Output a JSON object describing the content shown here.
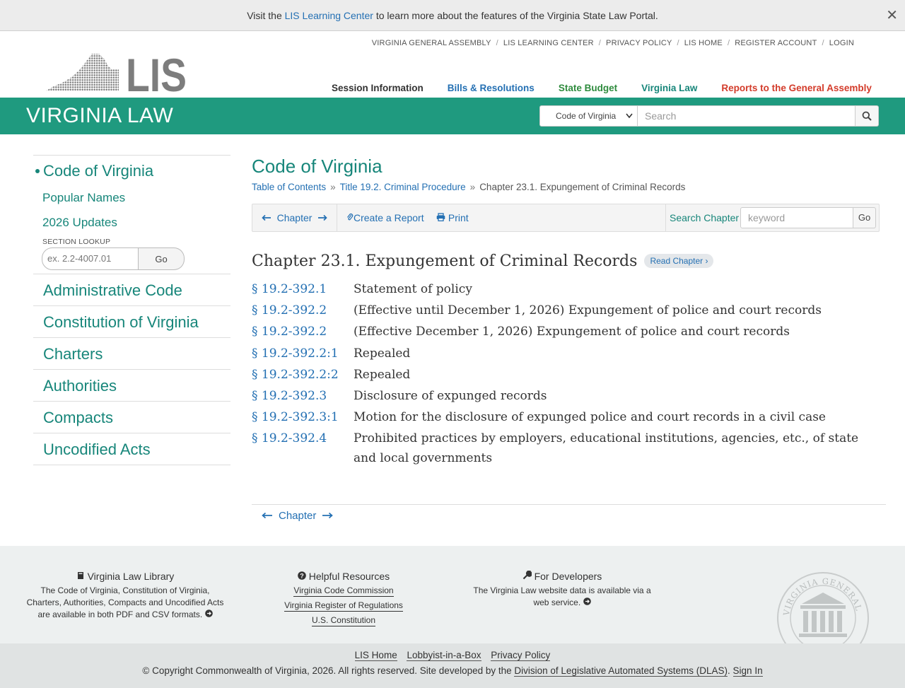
{
  "notice": {
    "before": "Visit the ",
    "link": "LIS Learning Center",
    "after": " to learn more about the features of the Virginia State Law Portal.",
    "close": "✕"
  },
  "topnav": [
    "VIRGINIA GENERAL ASSEMBLY",
    "LIS LEARNING CENTER",
    "PRIVACY POLICY",
    "LIS HOME",
    "REGISTER ACCOUNT",
    "LOGIN"
  ],
  "logo_text": "LIS",
  "mainnav": {
    "session": "Session Information",
    "bills": "Bills & Resolutions",
    "budget": "State Budget",
    "vlaw": "Virginia Law",
    "reports": "Reports to the General Assembly"
  },
  "banner": {
    "title": "VIRGINIA LAW",
    "scope_select": "Code of Virginia",
    "search_placeholder": "Search"
  },
  "sidebar": {
    "active": "Code of Virginia",
    "popular": "Popular Names",
    "updates": "2026 Updates",
    "lookup_label": "SECTION LOOKUP",
    "lookup_placeholder": "ex.  2.2-4007.01",
    "lookup_go": "Go",
    "items": [
      "Administrative Code",
      "Constitution of Virginia",
      "Charters",
      "Authorities",
      "Compacts",
      "Uncodified Acts"
    ]
  },
  "main": {
    "title": "Code of Virginia",
    "breadcrumb": [
      "Table of Contents",
      "Title 19.2. Criminal Procedure",
      "Chapter 23.1. Expungement of Criminal Records"
    ],
    "breadcrumb_sep": "»",
    "toolbar": {
      "chapter": "Chapter",
      "report": "Create a Report",
      "print": "Print",
      "search_label": "Search Chapter",
      "keyword_placeholder": "keyword",
      "go": "Go"
    },
    "chapter_heading": "Chapter 23.1. Expungement of Criminal Records",
    "read_chapter": "Read Chapter ›",
    "sections": [
      {
        "num": "§ 19.2-392.1",
        "title": "Statement of policy"
      },
      {
        "num": "§ 19.2-392.2",
        "title": "(Effective until December 1, 2026) Expungement of police and court records"
      },
      {
        "num": "§ 19.2-392.2",
        "title": "(Effective December 1, 2026) Expungement of police and court records"
      },
      {
        "num": "§ 19.2-392.2:1",
        "title": "Repealed"
      },
      {
        "num": "§ 19.2-392.2:2",
        "title": "Repealed"
      },
      {
        "num": "§ 19.2-392.3",
        "title": "Disclosure of expunged records"
      },
      {
        "num": "§ 19.2-392.3:1",
        "title": "Motion for the disclosure of expunged police and court records in a civil case"
      },
      {
        "num": "§ 19.2-392.4",
        "title": "Prohibited practices by employers, educational institutions, agencies, etc., of state and local governments"
      }
    ],
    "bottom_chapter": "Chapter"
  },
  "footer": {
    "library": {
      "heading": "Virginia Law Library",
      "text": "The Code of Virginia, Constitution of Virginia, Charters, Authorities, Compacts and Uncodified Acts are available in both PDF and CSV formats."
    },
    "resources": {
      "heading": "Helpful Resources",
      "links": [
        "Virginia Code Commission",
        "Virginia Register of Regulations",
        "U.S. Constitution"
      ]
    },
    "developers": {
      "heading": "For Developers",
      "text": "The Virginia Law website data is available via a web service."
    },
    "seal_text": "VIRGINIA GENERAL ASSEMBLY",
    "bottom_links": [
      "LIS Home",
      "Lobbyist-in-a-Box",
      "Privacy Policy"
    ],
    "copyright_before": "© Copyright Commonwealth of Virginia, 2026. All rights reserved. Site developed by the ",
    "dlas": "Division of Legislative Automated Systems (DLAS)",
    "sign_in": "Sign In"
  },
  "colors": {
    "brand_green": "#1f9a7f",
    "link_blue": "#2470b3",
    "teal_text": "#17867a",
    "reports_red": "#d33b2a"
  }
}
